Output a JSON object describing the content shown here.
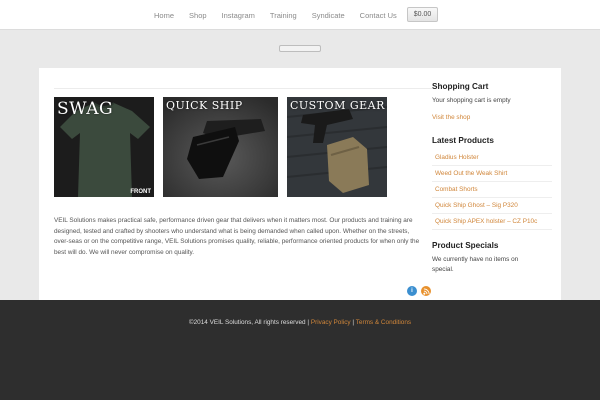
{
  "nav": {
    "items": [
      "Home",
      "Shop",
      "Instagram",
      "Training",
      "Syndicate",
      "Contact Us"
    ],
    "cart_total": "$0.00"
  },
  "promos": [
    {
      "label": "SWAG",
      "sublabel": "FRONT",
      "icon": "tshirt-image"
    },
    {
      "label": "QUICK SHIP",
      "icon": "holster-image"
    },
    {
      "label": "CUSTOM GEAR",
      "icon": "pistol-pouch-image"
    }
  ],
  "intro_text": "VEIL Solutions makes practical  safe, performance driven gear that delivers when it matters most. Our products and training are designed, tested and crafted by shooters who understand what is being demanded when called upon. Whether on the streets, over-seas or on the competitive range, VEIL Solutions promises quality, reliable, performance oriented products for when only the best will do. We will never compromise on quality.",
  "sidebar": {
    "cart_heading": "Shopping Cart",
    "cart_empty": "Your shopping cart is empty",
    "visit_shop": "Visit the shop",
    "latest_heading": "Latest Products",
    "latest_products": [
      "Gladius Holster",
      "Weed Out the Weak Shirt",
      "Combat Shorts",
      "Quick Ship Ghost – Sig P320",
      "Quick Ship APEX holster – CZ P10c"
    ],
    "specials_heading": "Product Specials",
    "specials_text": "We currently have no items on special."
  },
  "social": {
    "icons": [
      "info-icon",
      "rss-icon"
    ]
  },
  "footer": {
    "copyright": "©2014 VEIL Solutions, All rights reserved | ",
    "privacy": "Privacy Policy",
    "separator": " | ",
    "terms": "Terms & Conditions"
  },
  "colors": {
    "accent": "#d0863a",
    "footer_bg": "#2e2e2e",
    "page_bg": "#e9e9e9"
  }
}
